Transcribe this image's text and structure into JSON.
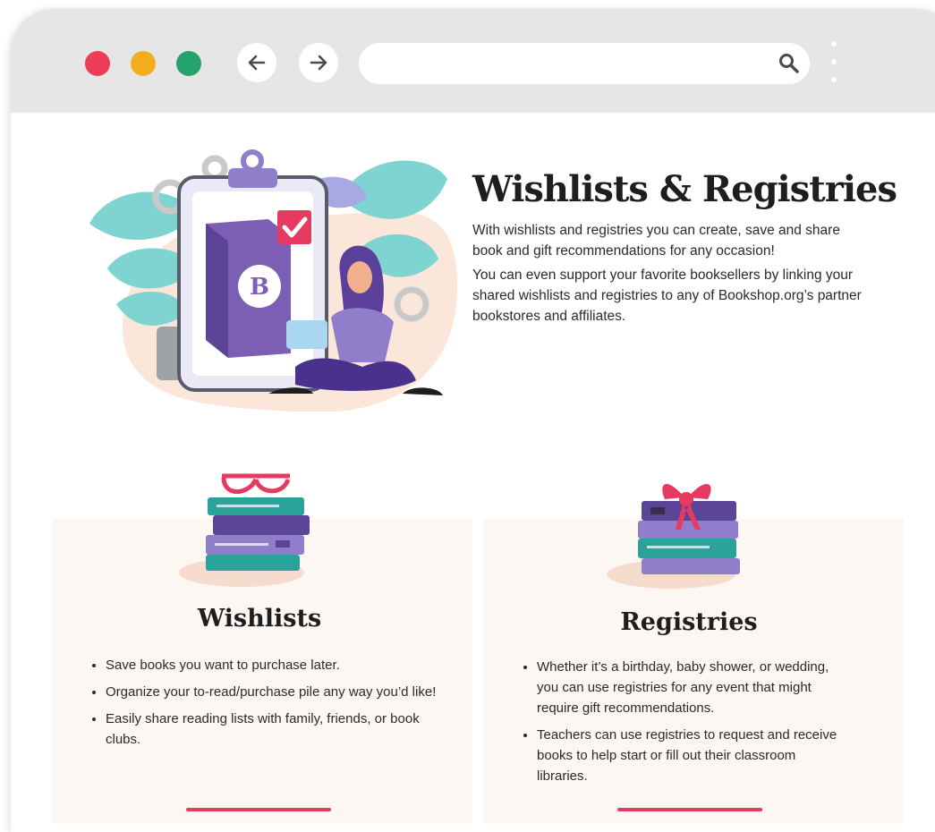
{
  "browser": {
    "window_controls": [
      "close",
      "minimize",
      "maximize"
    ],
    "nav": {
      "back_icon": "arrow-left-icon",
      "forward_icon": "arrow-right-icon"
    },
    "address_bar": {
      "value": "",
      "search_icon": "search-icon"
    },
    "menu_icon": "kebab-menu-icon"
  },
  "hero": {
    "title": "Wishlists & Registries",
    "paragraph_1": "With wishlists and registries you can create, save and share book and gift recommendations for any occasion!",
    "paragraph_2": "You can even support your favorite booksellers by linking your shared wishlists and registries to any of Bookshop.org’s partner bookstores and affiliates.",
    "illustration_badge_letter": "B"
  },
  "wishlists": {
    "title": "Wishlists",
    "bullets": [
      "Save books you want to purchase later.",
      "Organize your to-read/purchase pile any way you’d like!",
      "Easily share reading lists with family, friends, or book clubs."
    ]
  },
  "registries": {
    "title": "Registries",
    "bullets": [
      "Whether it’s a birthday, baby shower, or wedding, you can use registries for any event that might require gift recommendations.",
      "Teachers can use registries to request and receive books to help start or fill out their classroom libraries."
    ]
  },
  "colors": {
    "accent": "#e63a60",
    "purple": "#7c5fb5",
    "teal": "#2aa39a",
    "browser_chrome": "#e6e6e6",
    "card_background": "#fdf7f4"
  }
}
